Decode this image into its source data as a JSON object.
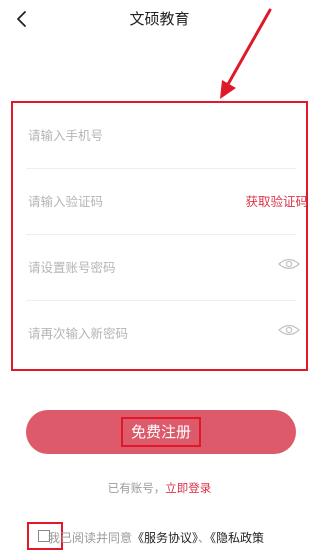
{
  "header": {
    "title": "文硕教育"
  },
  "form": {
    "phone_placeholder": "请输入手机号",
    "code_placeholder": "请输入验证码",
    "get_code": "获取验证码",
    "password_placeholder": "请设置账号密码",
    "confirm_placeholder": "请再次输入新密码"
  },
  "register_button": "免费注册",
  "login": {
    "prompt": "已有账号，",
    "link": "立即登录"
  },
  "agreement": {
    "prefix": "我已阅读并同意",
    "service": "《服务协议》",
    "separator": "、",
    "privacy": "《隐私政策"
  },
  "icons": {
    "back": "chevron-left-icon",
    "eye": "eye-icon"
  },
  "colors": {
    "accent": "#d9354a",
    "button": "#dc5a6a",
    "highlight": "#e0192a"
  }
}
